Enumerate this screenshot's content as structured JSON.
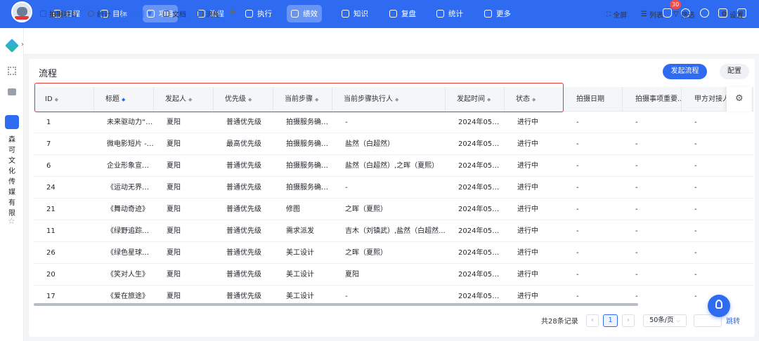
{
  "topnav": {
    "items": [
      {
        "label": "日程",
        "icon": "calendar-icon"
      },
      {
        "label": "目标",
        "icon": "target-icon"
      },
      {
        "label": "项目",
        "icon": "cube-icon"
      },
      {
        "label": "流程",
        "icon": "flow-icon"
      },
      {
        "label": "执行",
        "icon": "checklist-icon"
      },
      {
        "label": "绩效",
        "icon": "performance-icon"
      },
      {
        "label": "知识",
        "icon": "book-icon"
      },
      {
        "label": "复盘",
        "icon": "review-icon"
      },
      {
        "label": "统计",
        "icon": "pie-icon"
      },
      {
        "label": "更多",
        "icon": "grid-icon"
      }
    ],
    "notification_count": "30",
    "brand_color": "#2f6bf0"
  },
  "left_rail": {
    "company_name": [
      "森",
      "可",
      "文",
      "化",
      "传",
      "媒",
      "有",
      "限"
    ]
  },
  "subtabs": [
    {
      "label": "拍摄项目"
    },
    {
      "label": "统计"
    },
    {
      "label": "流程"
    },
    {
      "label": "文档"
    },
    {
      "label": "流程"
    }
  ],
  "subtab_add": "+",
  "tools": {
    "fullscreen": "全屏",
    "list": "列表",
    "filter": "筛选",
    "settings": "设置"
  },
  "page": {
    "title": "流程",
    "start_button": "发起流程",
    "config_button": "配置"
  },
  "table": {
    "columns": [
      "ID",
      "标题",
      "发起人",
      "优先级",
      "当前步骤",
      "当前步骤执行人",
      "发起时间",
      "状态",
      "拍摄日期",
      "拍摄事项重要...",
      "甲方对接人"
    ],
    "rows": [
      [
        "1",
        "未来驱动力“新...",
        "夏阳",
        "普通优先级",
        "拍摄服务确认单",
        "-",
        "2024年05月2...",
        "进行中",
        "-",
        "-",
        "-"
      ],
      [
        "7",
        "微电影短片 - “...",
        "夏阳",
        "最高优先级",
        "拍摄服务确认单",
        "盐然（白超然）",
        "2024年05月2...",
        "进行中",
        "-",
        "-",
        "-"
      ],
      [
        "6",
        "企业形象宣传...",
        "夏阳",
        "普通优先级",
        "拍摄服务确认单",
        "盐然（白超然）,之晖（夏熙）",
        "2024年05月2...",
        "进行中",
        "-",
        "-",
        "-"
      ],
      [
        "24",
        "《运动无界》-...",
        "夏阳",
        "普通优先级",
        "拍摄服务确认单",
        "-",
        "2024年05月2...",
        "进行中",
        "-",
        "-",
        "-"
      ],
      [
        "21",
        "《舞动奇迹》",
        "夏阳",
        "普通优先级",
        "修图",
        "之晖（夏熙）",
        "2024年05月2...",
        "进行中",
        "-",
        "-",
        "-"
      ],
      [
        "11",
        "《绿野追踪》-...",
        "夏阳",
        "普通优先级",
        "需求派发",
        "吉木（刘镇武）,盐然（白超然...",
        "2024年05月2...",
        "进行中",
        "-",
        "-",
        "-"
      ],
      [
        "26",
        "《绿色星球》-...",
        "夏阳",
        "普通优先级",
        "美工设计",
        "之晖（夏熙）",
        "2024年05月2...",
        "进行中",
        "-",
        "-",
        "-"
      ],
      [
        "20",
        "《笑对人生》",
        "夏阳",
        "普通优先级",
        "美工设计",
        "夏阳",
        "2024年05月2...",
        "进行中",
        "-",
        "-",
        "-"
      ],
      [
        "17",
        "《爱在旅途》",
        "夏阳",
        "普通优先级",
        "美工设计",
        "-",
        "2024年05月2...",
        "进行中",
        "-",
        "-",
        "-"
      ]
    ]
  },
  "pagination": {
    "total": "共28条记录",
    "prev": "‹",
    "current": "1",
    "next": "›",
    "page_size": "50条/页",
    "jump": "跳转"
  }
}
